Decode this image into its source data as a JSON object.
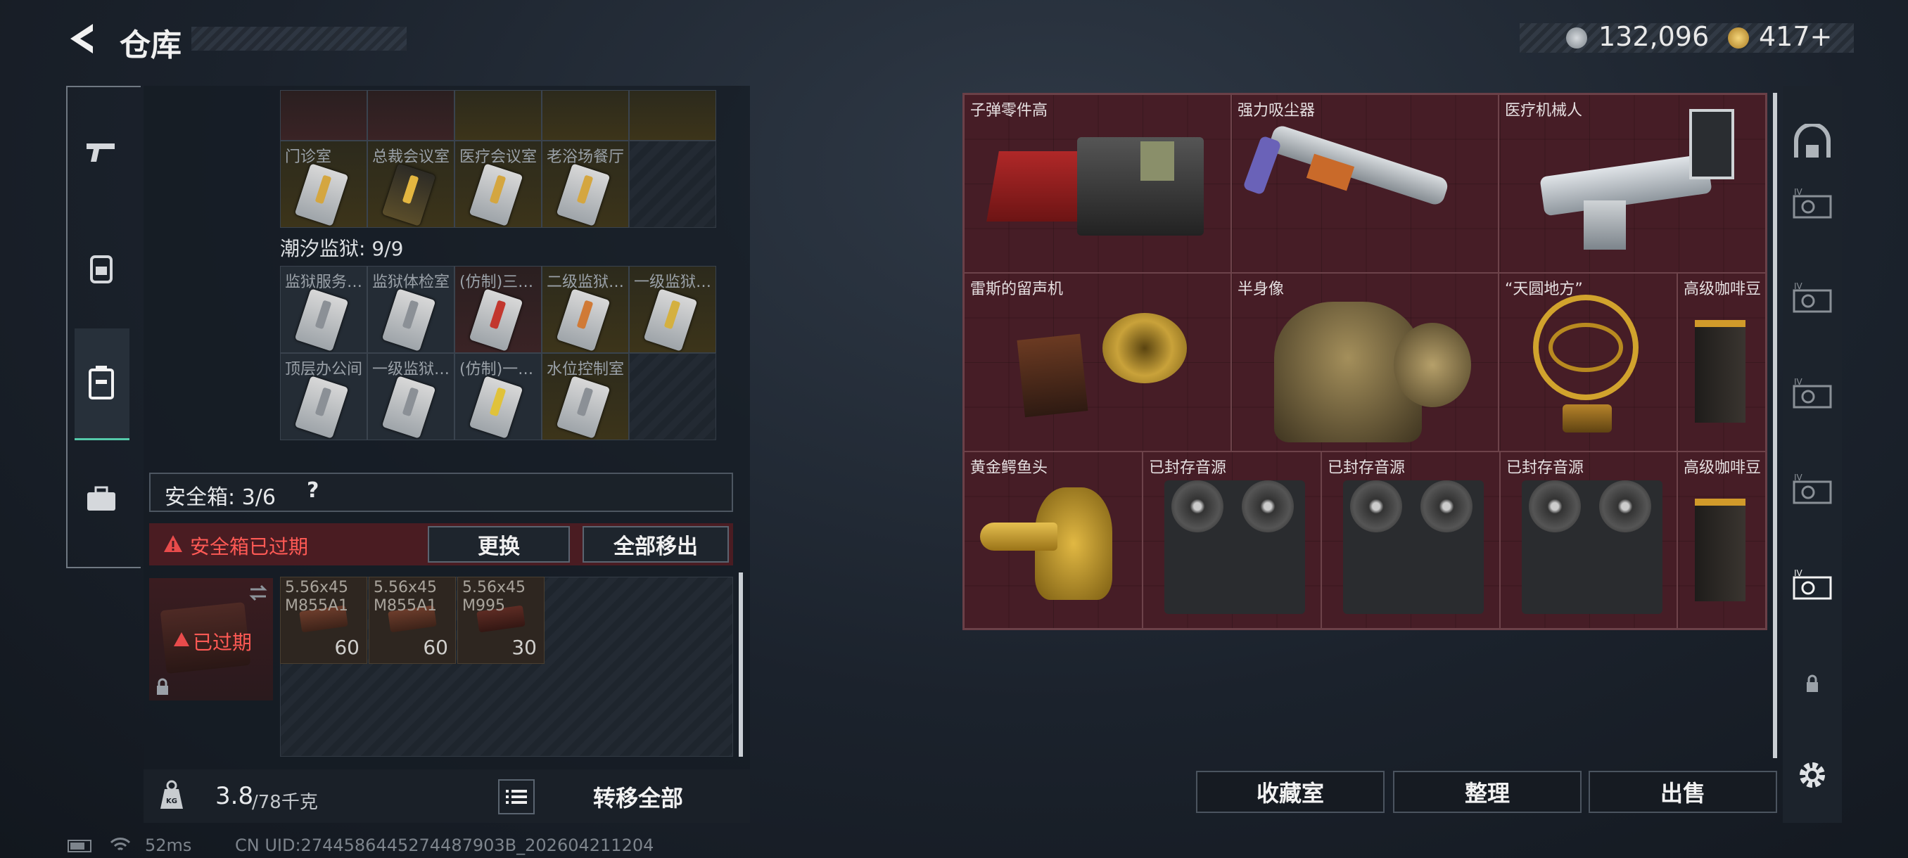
{
  "header": {
    "title": "仓库"
  },
  "currency": [
    {
      "icon": "silver-coin-icon",
      "value": "132,096"
    },
    {
      "icon": "gold-coin-icon",
      "value": "417+"
    }
  ],
  "rail": [
    {
      "icon": "gun-icon"
    },
    {
      "icon": "backpack-icon"
    },
    {
      "icon": "safe-box-icon",
      "active": true
    },
    {
      "icon": "toolbox-icon"
    }
  ],
  "keycards_top": {
    "labels": [
      "门诊室",
      "总裁会议室",
      "医疗会议室",
      "老浴场餐厅"
    ]
  },
  "prison": {
    "title": "潮汐监狱: 9/9",
    "row1": [
      "监狱服务…",
      "监狱体检室",
      "(仿制)三…",
      "二级监狱…",
      "一级监狱…"
    ],
    "row2": [
      "顶层办公间",
      "一级监狱…",
      "(仿制)一…",
      "水位控制室"
    ]
  },
  "safe": {
    "label": "安全箱: 3/6",
    "help": "?",
    "warning": "安全箱已过期",
    "replace_btn": "更换",
    "move_all_btn": "全部移出",
    "expired_label": "已过期",
    "ammo": [
      {
        "name_l1": "5.56x45",
        "name_l2": "M855A1",
        "count": "60"
      },
      {
        "name_l1": "5.56x45",
        "name_l2": "M855A1",
        "count": "60"
      },
      {
        "name_l1": "5.56x45",
        "name_l2": "M995",
        "count": "30"
      }
    ]
  },
  "weight": {
    "value": "3.8",
    "max": "/78千克"
  },
  "transfer_all_btn": "转移全部",
  "stash_items": [
    {
      "name": "子弹零件高"
    },
    {
      "name": "强力吸尘器"
    },
    {
      "name": "医疗机械人"
    },
    {
      "name": "雷斯的留声机"
    },
    {
      "name": "半身像"
    },
    {
      "name": "“天圆地方”"
    },
    {
      "name": "高级咖啡豆"
    },
    {
      "name": "黄金鳄鱼头"
    },
    {
      "name": "已封存音源"
    },
    {
      "name": "已封存音源"
    },
    {
      "name": "已封存音源"
    },
    {
      "name": "高级咖啡豆"
    }
  ],
  "bottom_buttons": {
    "collection": "收藏室",
    "sort": "整理",
    "sell": "出售"
  },
  "status": {
    "ping": "52ms",
    "uid": "CN UID:2744586445274487903B_202604211204"
  }
}
